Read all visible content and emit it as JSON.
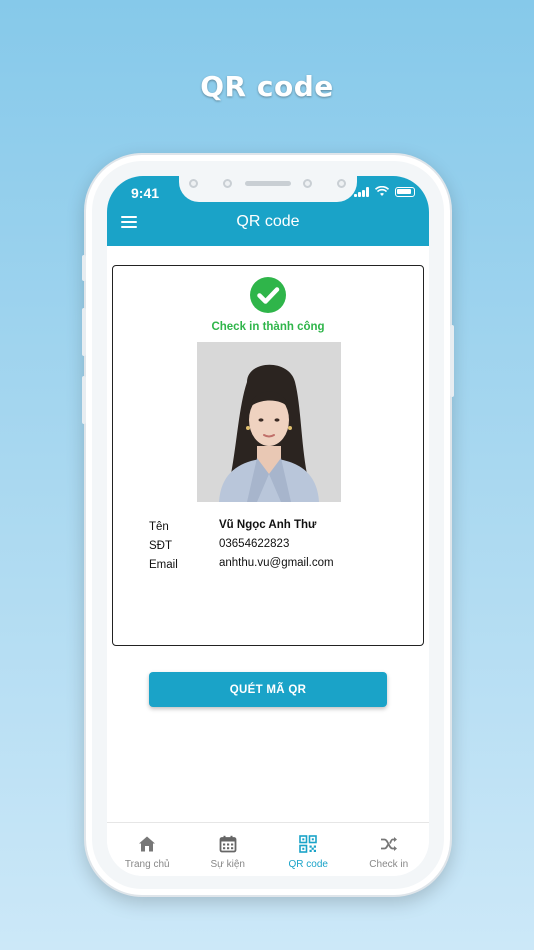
{
  "headline": "QR code",
  "status_bar": {
    "time": "9:41"
  },
  "app_bar": {
    "title": "QR code",
    "menu_icon": "menu-icon"
  },
  "checkin": {
    "status_icon": "check-circle-icon",
    "status_text": "Check in thành công",
    "status_color": "#2fb54a"
  },
  "attendee": {
    "fields": [
      {
        "label": "Tên",
        "value": "Vũ Ngọc Anh Thư"
      },
      {
        "label": "SĐT",
        "value": "03654622823"
      },
      {
        "label": "Email",
        "value": "anhthu.vu@gmail.com"
      }
    ]
  },
  "scan_button": "QUÉT MÃ QR",
  "tabs": [
    {
      "label": "Trang chủ",
      "icon": "home-icon",
      "active": false
    },
    {
      "label": "Sự kiện",
      "icon": "calendar-icon",
      "active": false
    },
    {
      "label": "QR code",
      "icon": "qr-code-icon",
      "active": true
    },
    {
      "label": "Check in",
      "icon": "shuffle-icon",
      "active": false
    }
  ],
  "colors": {
    "accent": "#1aa3c8",
    "success": "#2fb54a",
    "inactive": "#888888"
  }
}
